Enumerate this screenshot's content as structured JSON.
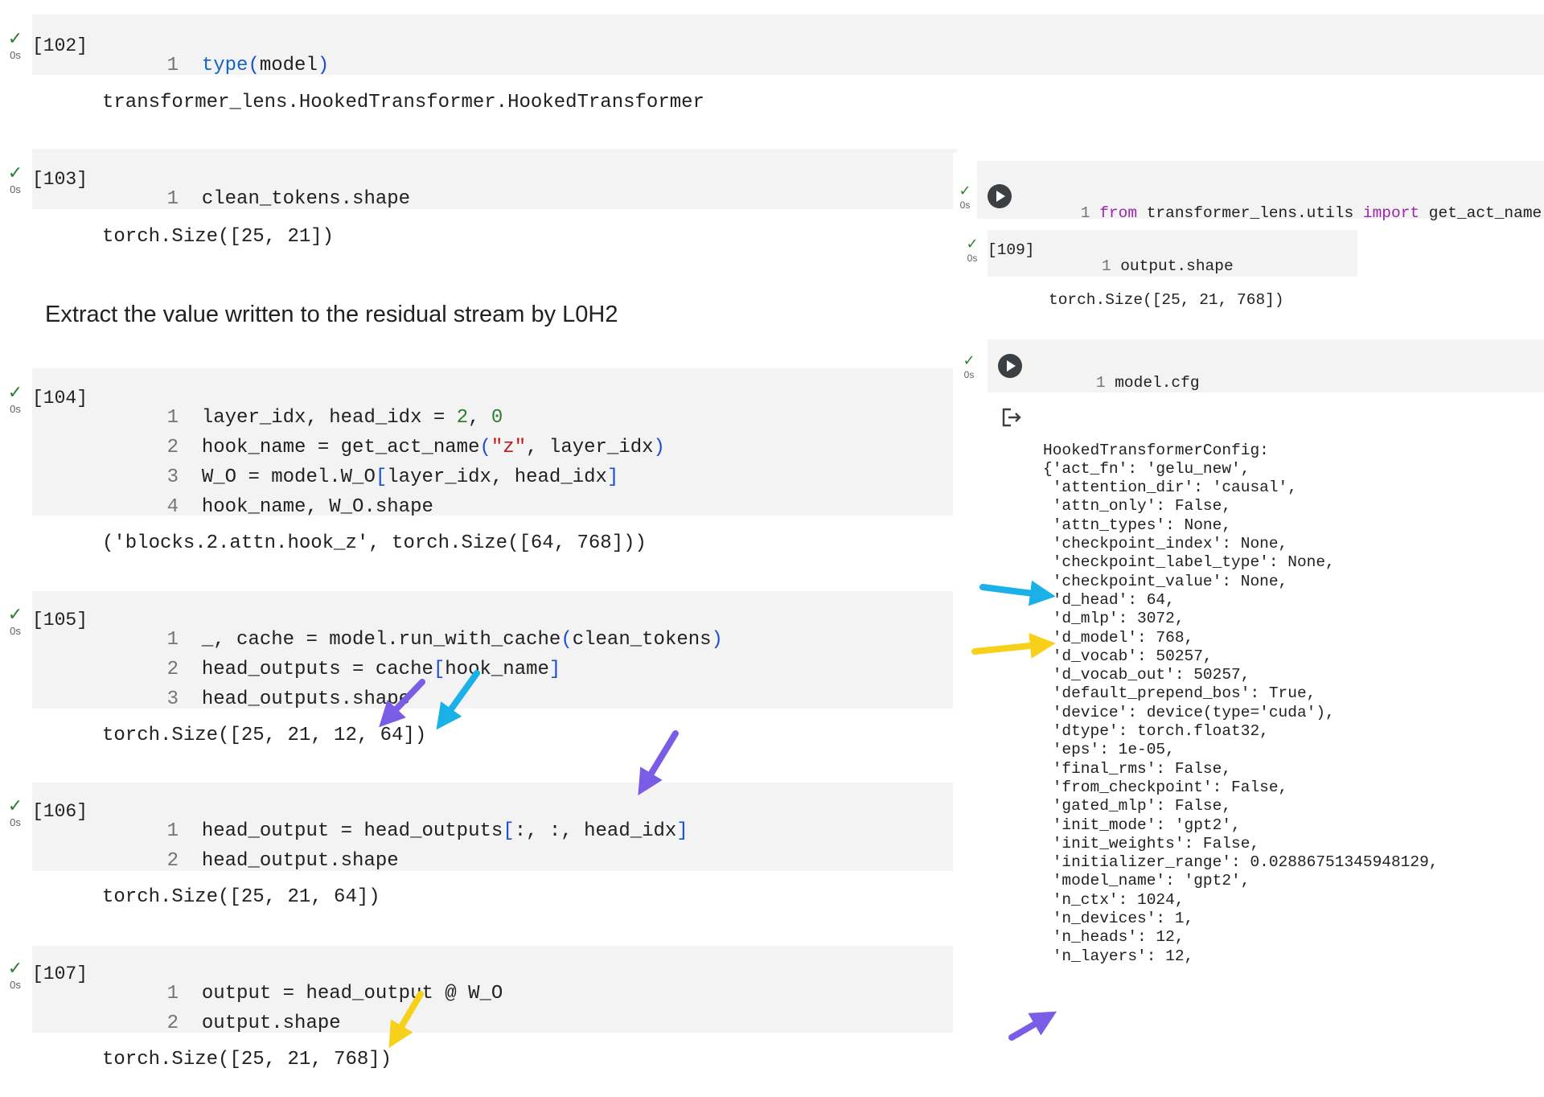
{
  "cells": {
    "c102": {
      "prompt": "[102]",
      "status_time": "0s",
      "line1": {
        "ln": "1",
        "fn": "type",
        "paren_open": "(",
        "arg": "model",
        "paren_close": ")"
      },
      "output": "transformer_lens.HookedTransformer.HookedTransformer"
    },
    "c103": {
      "prompt": "[103]",
      "status_time": "0s",
      "line1": {
        "ln": "1",
        "code": "clean_tokens.shape"
      },
      "output": "torch.Size([25, 21])"
    },
    "markdown": "Extract the value written to the residual stream by L0H2",
    "c104": {
      "prompt": "[104]",
      "status_time": "0s",
      "line1": {
        "ln": "1",
        "a": "layer_idx, head_idx = ",
        "n1": "2",
        "b": ", ",
        "n2": "0"
      },
      "line2": {
        "ln": "2",
        "a": "hook_name = get_act_name",
        "p1": "(",
        "s": "\"z\"",
        "b": ", layer_idx",
        "p2": ")"
      },
      "line3": {
        "ln": "3",
        "a": "W_O = model.W_O",
        "p1": "[",
        "b": "layer_idx, head_idx",
        "p2": "]"
      },
      "line4": {
        "ln": "4",
        "code": "hook_name, W_O.shape"
      },
      "output": "('blocks.2.attn.hook_z', torch.Size([64, 768]))"
    },
    "c105": {
      "prompt": "[105]",
      "status_time": "0s",
      "line1": {
        "ln": "1",
        "a": "_, cache = model.run_with_cache",
        "p1": "(",
        "b": "clean_tokens",
        "p2": ")"
      },
      "line2": {
        "ln": "2",
        "a": "head_outputs = cache",
        "p1": "[",
        "b": "hook_name",
        "p2": "]"
      },
      "line3": {
        "ln": "3",
        "code": "head_outputs.shape"
      },
      "output": "torch.Size([25, 21, 12, 64])"
    },
    "c106": {
      "prompt": "[106]",
      "status_time": "0s",
      "line1": {
        "ln": "1",
        "a": "head_output = head_outputs",
        "p1": "[",
        "b": ":, :, head_idx",
        "p2": "]"
      },
      "line2": {
        "ln": "2",
        "code": "head_output.shape"
      },
      "output": "torch.Size([25, 21, 64])"
    },
    "c107": {
      "prompt": "[107]",
      "status_time": "0s",
      "line1": {
        "ln": "1",
        "code": "output = head_output @ W_O"
      },
      "line2": {
        "ln": "2",
        "code": "output.shape"
      },
      "output": "torch.Size([25, 21, 768])"
    }
  },
  "right": {
    "import_cell": {
      "status_time": "0s",
      "ln": "1",
      "kw_from": "from",
      "module": " transformer_lens.utils ",
      "kw_import": "import",
      "name": " get_act_name"
    },
    "c109": {
      "prompt": "[109]",
      "status_time": "0s",
      "line1": {
        "ln": "1",
        "code": "output.shape"
      },
      "output": "torch.Size([25, 21, 768])"
    },
    "cfg_cell": {
      "status_time": "0s",
      "line1": {
        "ln": "1",
        "code": "model.cfg"
      },
      "output_lines": [
        "HookedTransformerConfig:",
        "{'act_fn': 'gelu_new',",
        " 'attention_dir': 'causal',",
        " 'attn_only': False,",
        " 'attn_types': None,",
        " 'checkpoint_index': None,",
        " 'checkpoint_label_type': None,",
        " 'checkpoint_value': None,",
        " 'd_head': 64,",
        " 'd_mlp': 3072,",
        " 'd_model': 768,",
        " 'd_vocab': 50257,",
        " 'd_vocab_out': 50257,",
        " 'default_prepend_bos': True,",
        " 'device': device(type='cuda'),",
        " 'dtype': torch.float32,",
        " 'eps': 1e-05,",
        " 'final_rms': False,",
        " 'from_checkpoint': False,",
        " 'gated_mlp': False,",
        " 'init_mode': 'gpt2',",
        " 'init_weights': False,",
        " 'initializer_range': 0.02886751345948129,",
        " 'model_name': 'gpt2',",
        " 'n_ctx': 1024,",
        " 'n_devices': 1,",
        " 'n_heads': 12,",
        " 'n_layers': 12,"
      ]
    }
  },
  "status_check": "✓",
  "colors": {
    "arrow_purple": "#7b5ce6",
    "arrow_blue": "#1ab0e8",
    "arrow_yellow": "#f7d01a",
    "cell_bg": "#f3f3f3",
    "check_green": "#2e7d32"
  },
  "icons": {
    "run": "play-circle-icon",
    "output": "output-redirect-icon",
    "status": "check-icon"
  }
}
